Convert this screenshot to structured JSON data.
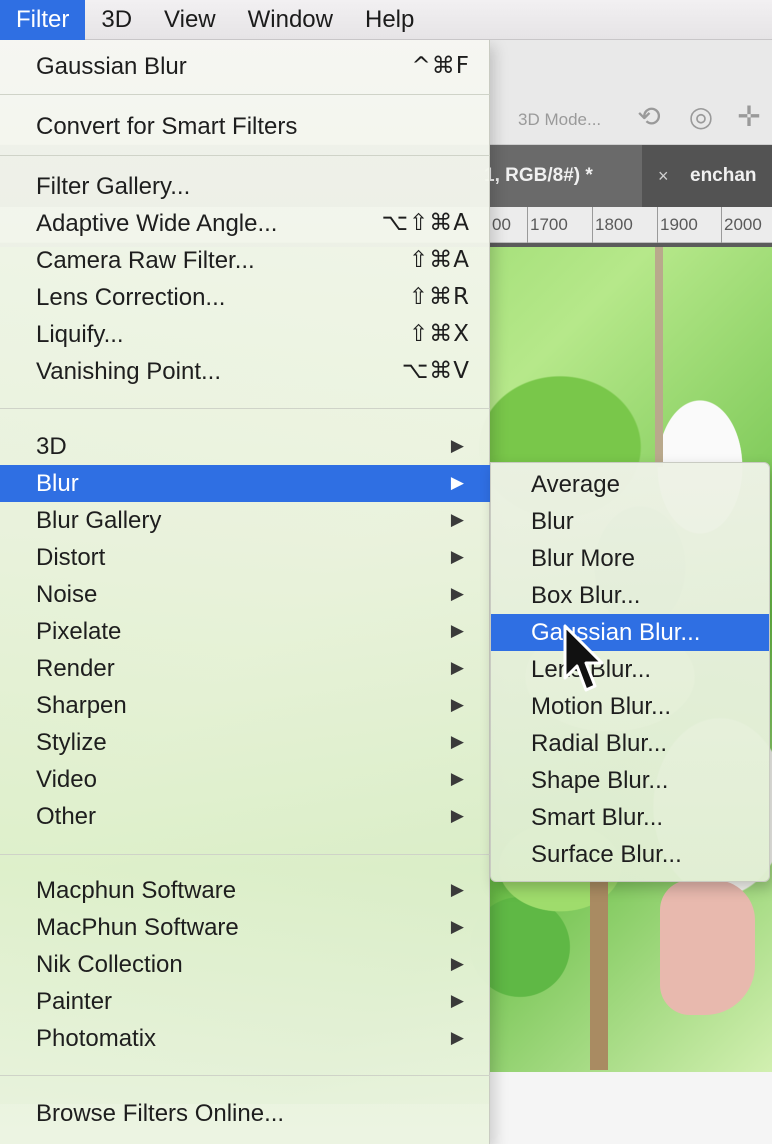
{
  "menubar": {
    "items": [
      "Filter",
      "3D",
      "View",
      "Window",
      "Help"
    ]
  },
  "options_bar": {
    "mode_label": "3D Mode..."
  },
  "document_tabs": {
    "active_tab": "1, RGB/8#) *",
    "close_glyph": "×",
    "other_tab": "enchan"
  },
  "ruler": {
    "ticks": [
      "00",
      "1700",
      "1800",
      "1900",
      "2000"
    ]
  },
  "filter_menu": {
    "last_filter": {
      "label": "Gaussian Blur",
      "shortcut": "^⌘F"
    },
    "convert": {
      "label": "Convert for Smart Filters"
    },
    "special": [
      {
        "label": "Filter Gallery...",
        "shortcut": ""
      },
      {
        "label": "Adaptive Wide Angle...",
        "shortcut": "⌥⇧⌘A"
      },
      {
        "label": "Camera Raw Filter...",
        "shortcut": "⇧⌘A"
      },
      {
        "label": "Lens Correction...",
        "shortcut": "⇧⌘R"
      },
      {
        "label": "Liquify...",
        "shortcut": "⇧⌘X"
      },
      {
        "label": "Vanishing Point...",
        "shortcut": "⌥⌘V"
      }
    ],
    "categories": [
      "3D",
      "Blur",
      "Blur Gallery",
      "Distort",
      "Noise",
      "Pixelate",
      "Render",
      "Sharpen",
      "Stylize",
      "Video",
      "Other"
    ],
    "highlighted_category": "Blur",
    "plugins": [
      "Macphun Software",
      "MacPhun Software",
      "Nik Collection",
      "Painter",
      "Photomatix"
    ],
    "browse": {
      "label": "Browse Filters Online..."
    },
    "submenu_arrow": "▶"
  },
  "blur_submenu": {
    "items": [
      "Average",
      "Blur",
      "Blur More",
      "Box Blur...",
      "Gaussian Blur...",
      "Lens Blur...",
      "Motion Blur...",
      "Radial Blur...",
      "Shape Blur...",
      "Smart Blur...",
      "Surface Blur..."
    ],
    "highlighted_item": "Gaussian Blur..."
  },
  "colors": {
    "highlight": "#2f6fe3",
    "menu_text": "#1e1e1e"
  }
}
